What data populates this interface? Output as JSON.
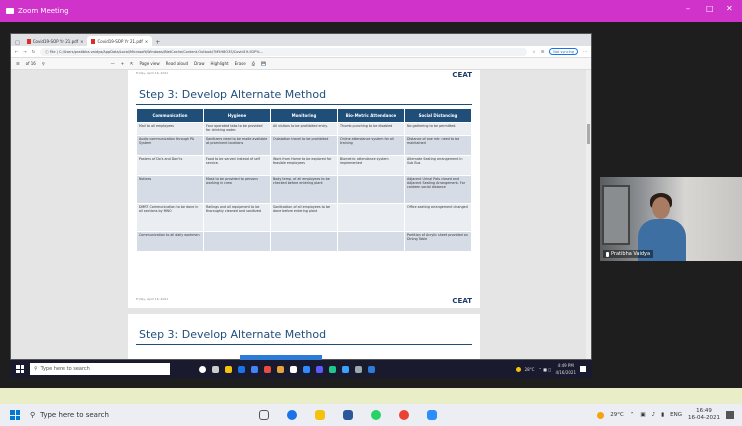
{
  "zoom": {
    "title": "Zoom Meeting",
    "min_icon": "minimize-icon",
    "max_icon": "maximize-icon",
    "close_icon": "close-icon",
    "bg_color": "#1e1e1e",
    "titlebar_color": "#d033c9"
  },
  "browser": {
    "tabs": [
      {
        "label": "Covid19-SOP Yr 21.pdf"
      },
      {
        "label": "Covid19-SOP Yr 21.pdf"
      }
    ],
    "new_tab": "+",
    "address_prefix": "File",
    "url": "C:/Users/pratibha.vaidya/AppData/Local/Microsoft/Windows/INetCache/Content.Outlook/7M5H8O3S/Covid19-SOP%...",
    "sync_label": "Not syncing"
  },
  "pdf_toolbar": {
    "page_info": "of 16",
    "search_icon": "search-icon",
    "zoom_out": "—",
    "zoom_in": "+",
    "page_view": "Page view",
    "read_aloud": "Read aloud",
    "draw": "Draw",
    "highlight": "Highlight",
    "erase": "Erase"
  },
  "page1": {
    "footer_left": "Friday, April 16, 2021",
    "logo": "CEAT",
    "title": "Step 3: Develop Alternate Method",
    "headers": [
      "Communication",
      "Hygiene",
      "Monitoring",
      "Bio-Metric Attendance",
      "Social Distancing"
    ],
    "rows": [
      [
        "Mail to all employees",
        "Four operated tabs to be provided for drinking water.",
        "All visitors to be prohibited entry.",
        "Thumb punching to be disabled",
        "No gathering to be permitted."
      ],
      [
        "Audio communication through PA System",
        "Sanitizers need to be made available at prominent locations",
        "Outstation travel to be prohibited",
        "Online attendance system for all training",
        "Distance of one mtr. need to be maintained"
      ],
      [
        "Posters of Do's and Don'ts",
        "Food to be served instead of self service.",
        "Work from Home to be explored for feasible employees",
        "Biometric attendance system implemented",
        "Alternate Seating arrangement in Sub Bus"
      ],
      [
        "Notices",
        "Mask to be provided to persons working in crew",
        "Body temp. of all employees to be checked before entering plant",
        "",
        "Adjacent Urinal Pots closed and Adjacent Seating Arrangement. For canteen social distance"
      ],
      [
        "DMRT Communication to be done in all sections by MNO",
        "Railings and all equipment to be thoroughly cleaned and sanitized",
        "Sanitization of all employees to be done before entering plant",
        "",
        "Office seating arrangement changed"
      ],
      [
        "Communication to all daily workmen",
        "",
        "",
        "",
        "Partition of Acrylic sheet provided on Dining Table"
      ]
    ],
    "footer2_left": "Friday, April 16, 2021",
    "footer2_logo": "CEAT"
  },
  "page2": {
    "title": "Step 3: Develop Alternate Method"
  },
  "inner_taskbar": {
    "search": "Type here to search",
    "weather": "28°C",
    "time": "4:49 PM",
    "date": "4/16/2021"
  },
  "participant": {
    "name": "Pratibha Vaidya"
  },
  "outer_taskbar": {
    "search": "Type here to search",
    "weather": "29°C",
    "lang": "ENG",
    "time": "16:49",
    "date": "16-04-2021"
  }
}
